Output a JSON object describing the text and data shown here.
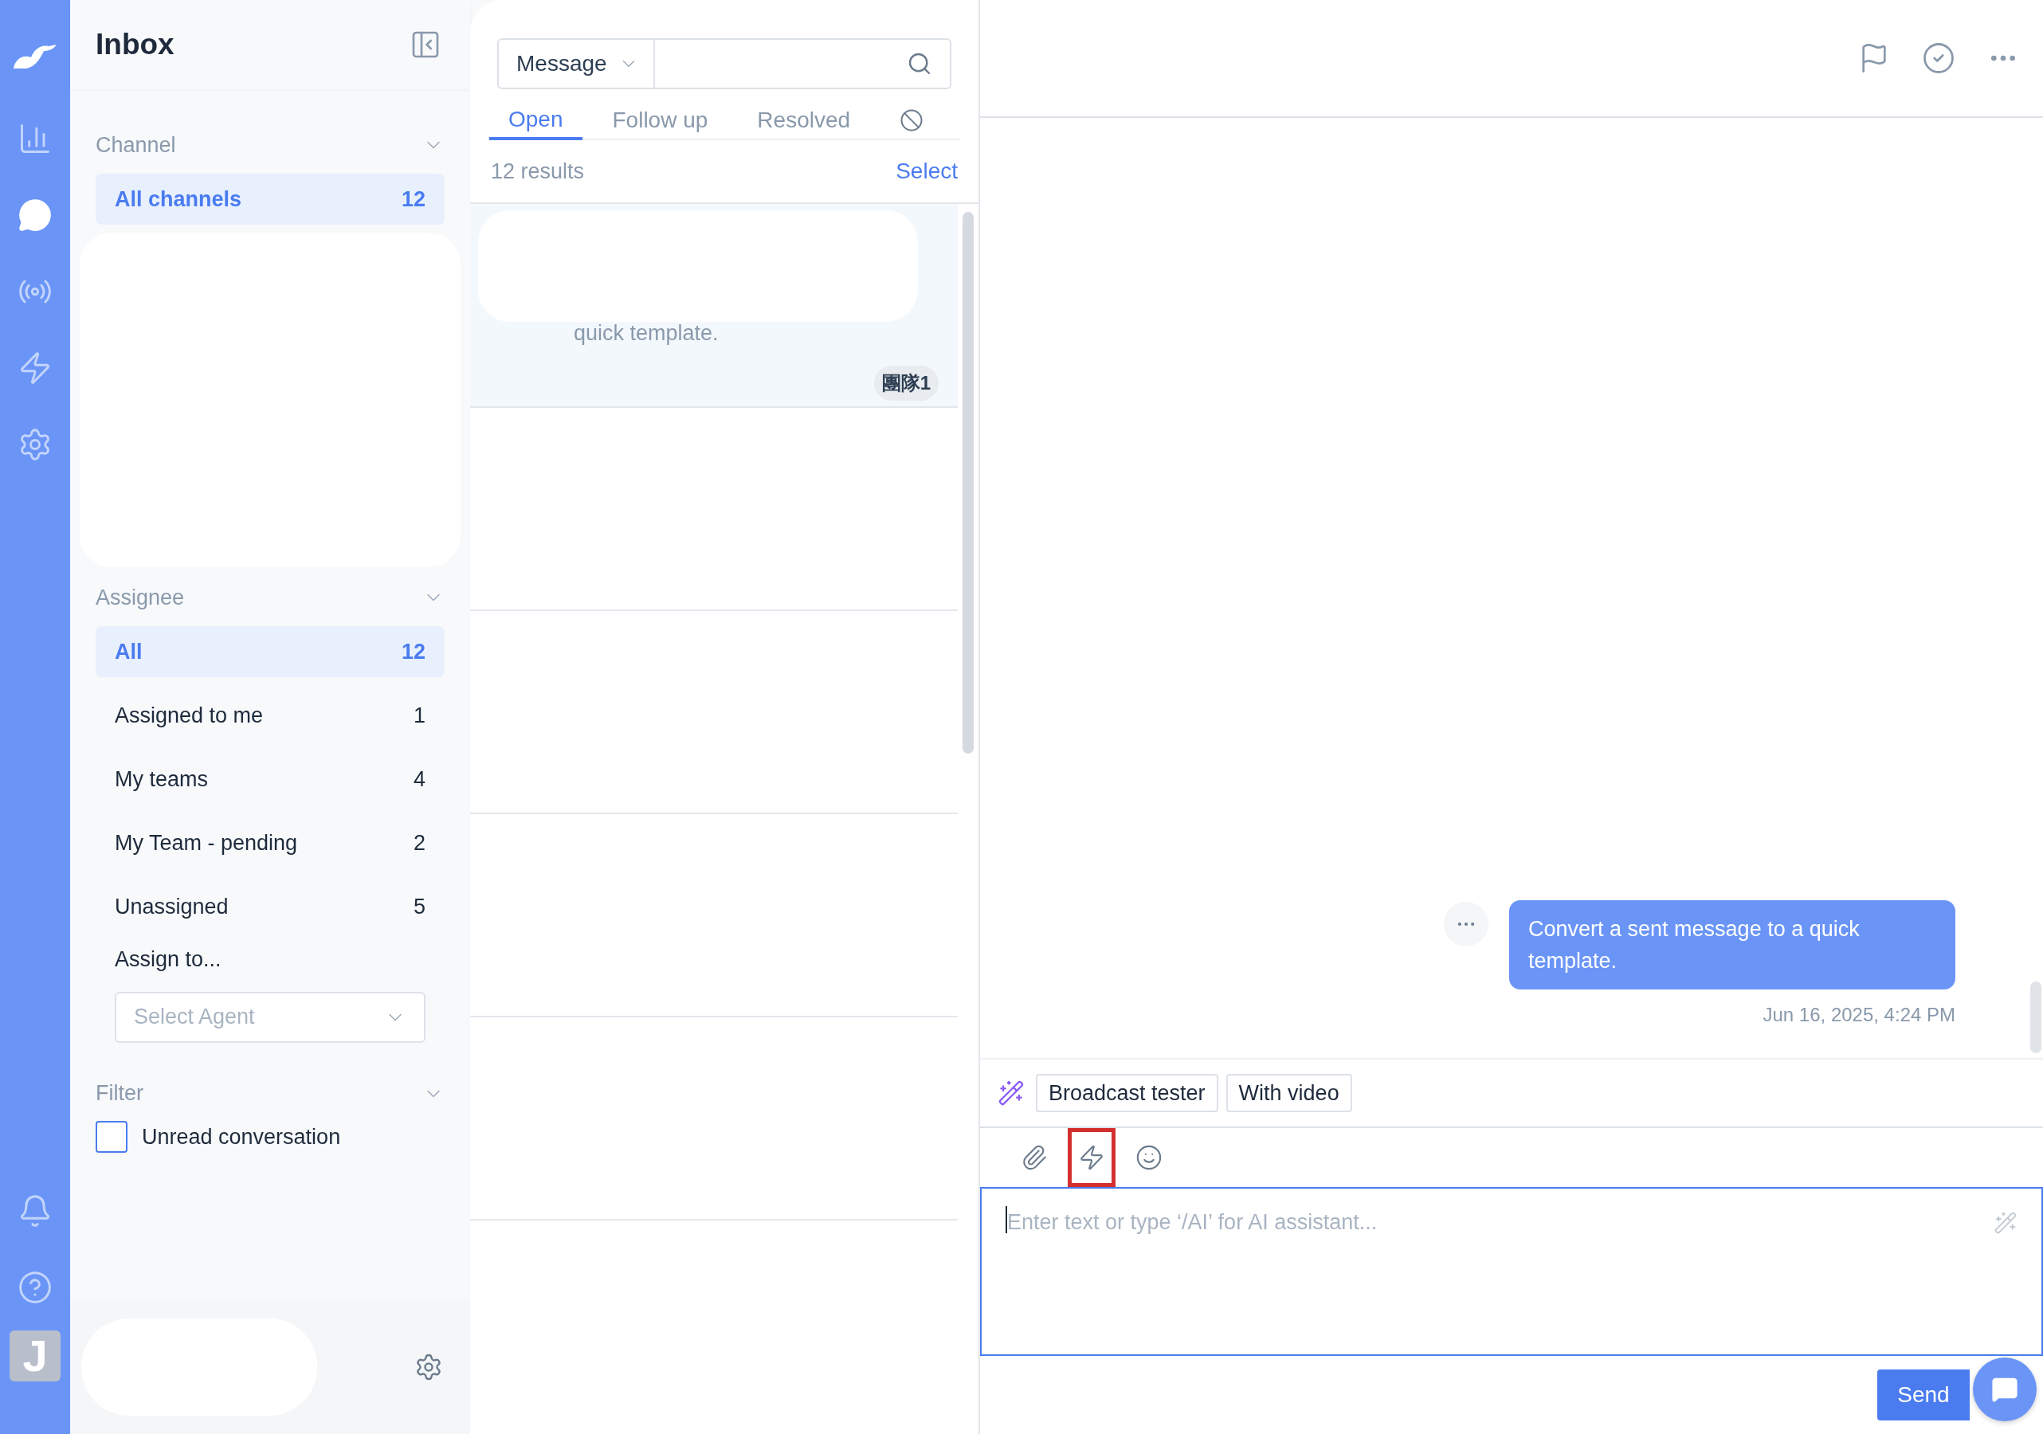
{
  "rail": {
    "items": [
      {
        "kind": "reports",
        "selected": false
      },
      {
        "kind": "inbox",
        "selected": true
      },
      {
        "kind": "broadcast",
        "selected": false
      },
      {
        "kind": "automation",
        "selected": false
      },
      {
        "kind": "settings",
        "selected": false
      }
    ],
    "bottom": [
      {
        "kind": "notifications"
      },
      {
        "kind": "help"
      }
    ],
    "avatar": "J"
  },
  "sidebar": {
    "title": "Inbox",
    "channel": {
      "title": "Channel",
      "items": [
        {
          "label": "All channels",
          "count": "12",
          "selected": true
        }
      ]
    },
    "assignee": {
      "title": "Assignee",
      "items": [
        {
          "label": "All",
          "count": "12",
          "selected": true
        },
        {
          "label": "Assigned to me",
          "count": "1",
          "selected": false
        },
        {
          "label": "My teams",
          "count": "4",
          "selected": false
        },
        {
          "label": "My Team - pending",
          "count": "2",
          "selected": false
        },
        {
          "label": "Unassigned",
          "count": "5",
          "selected": false
        }
      ],
      "assign_label": "Assign to...",
      "agent_select": {
        "placeholder": "Select Agent"
      }
    },
    "filter": {
      "title": "Filter",
      "options": [
        {
          "label": "Unread conversation",
          "checked": false
        }
      ]
    }
  },
  "conversations": {
    "search": {
      "scope": "Message"
    },
    "tabs": [
      {
        "kind": "text",
        "label": "Open",
        "selected": true
      },
      {
        "kind": "text",
        "label": "Follow up",
        "selected": false
      },
      {
        "kind": "text",
        "label": "Resolved",
        "selected": false
      },
      {
        "kind": "blocked",
        "selected": false
      }
    ],
    "result_count": "12 results",
    "select_link": "Select",
    "items": [
      {
        "preview": "quick template.",
        "tag": "團隊1",
        "selected": true
      }
    ]
  },
  "chat": {
    "messages": [
      {
        "text": "Convert a sent message to a quick template.",
        "time": "Jun 16, 2025, 4:24 PM",
        "outgoing": true
      }
    ],
    "quick_replies": [
      "Broadcast tester",
      "With video"
    ],
    "tools": [
      {
        "kind": "attach",
        "highlighted": false
      },
      {
        "kind": "quick-reply",
        "highlighted": true
      },
      {
        "kind": "emoji",
        "highlighted": false
      }
    ],
    "composer": {
      "placeholder": "Enter text or type ‘/AI’ for AI assistant..."
    },
    "send": "Send"
  }
}
